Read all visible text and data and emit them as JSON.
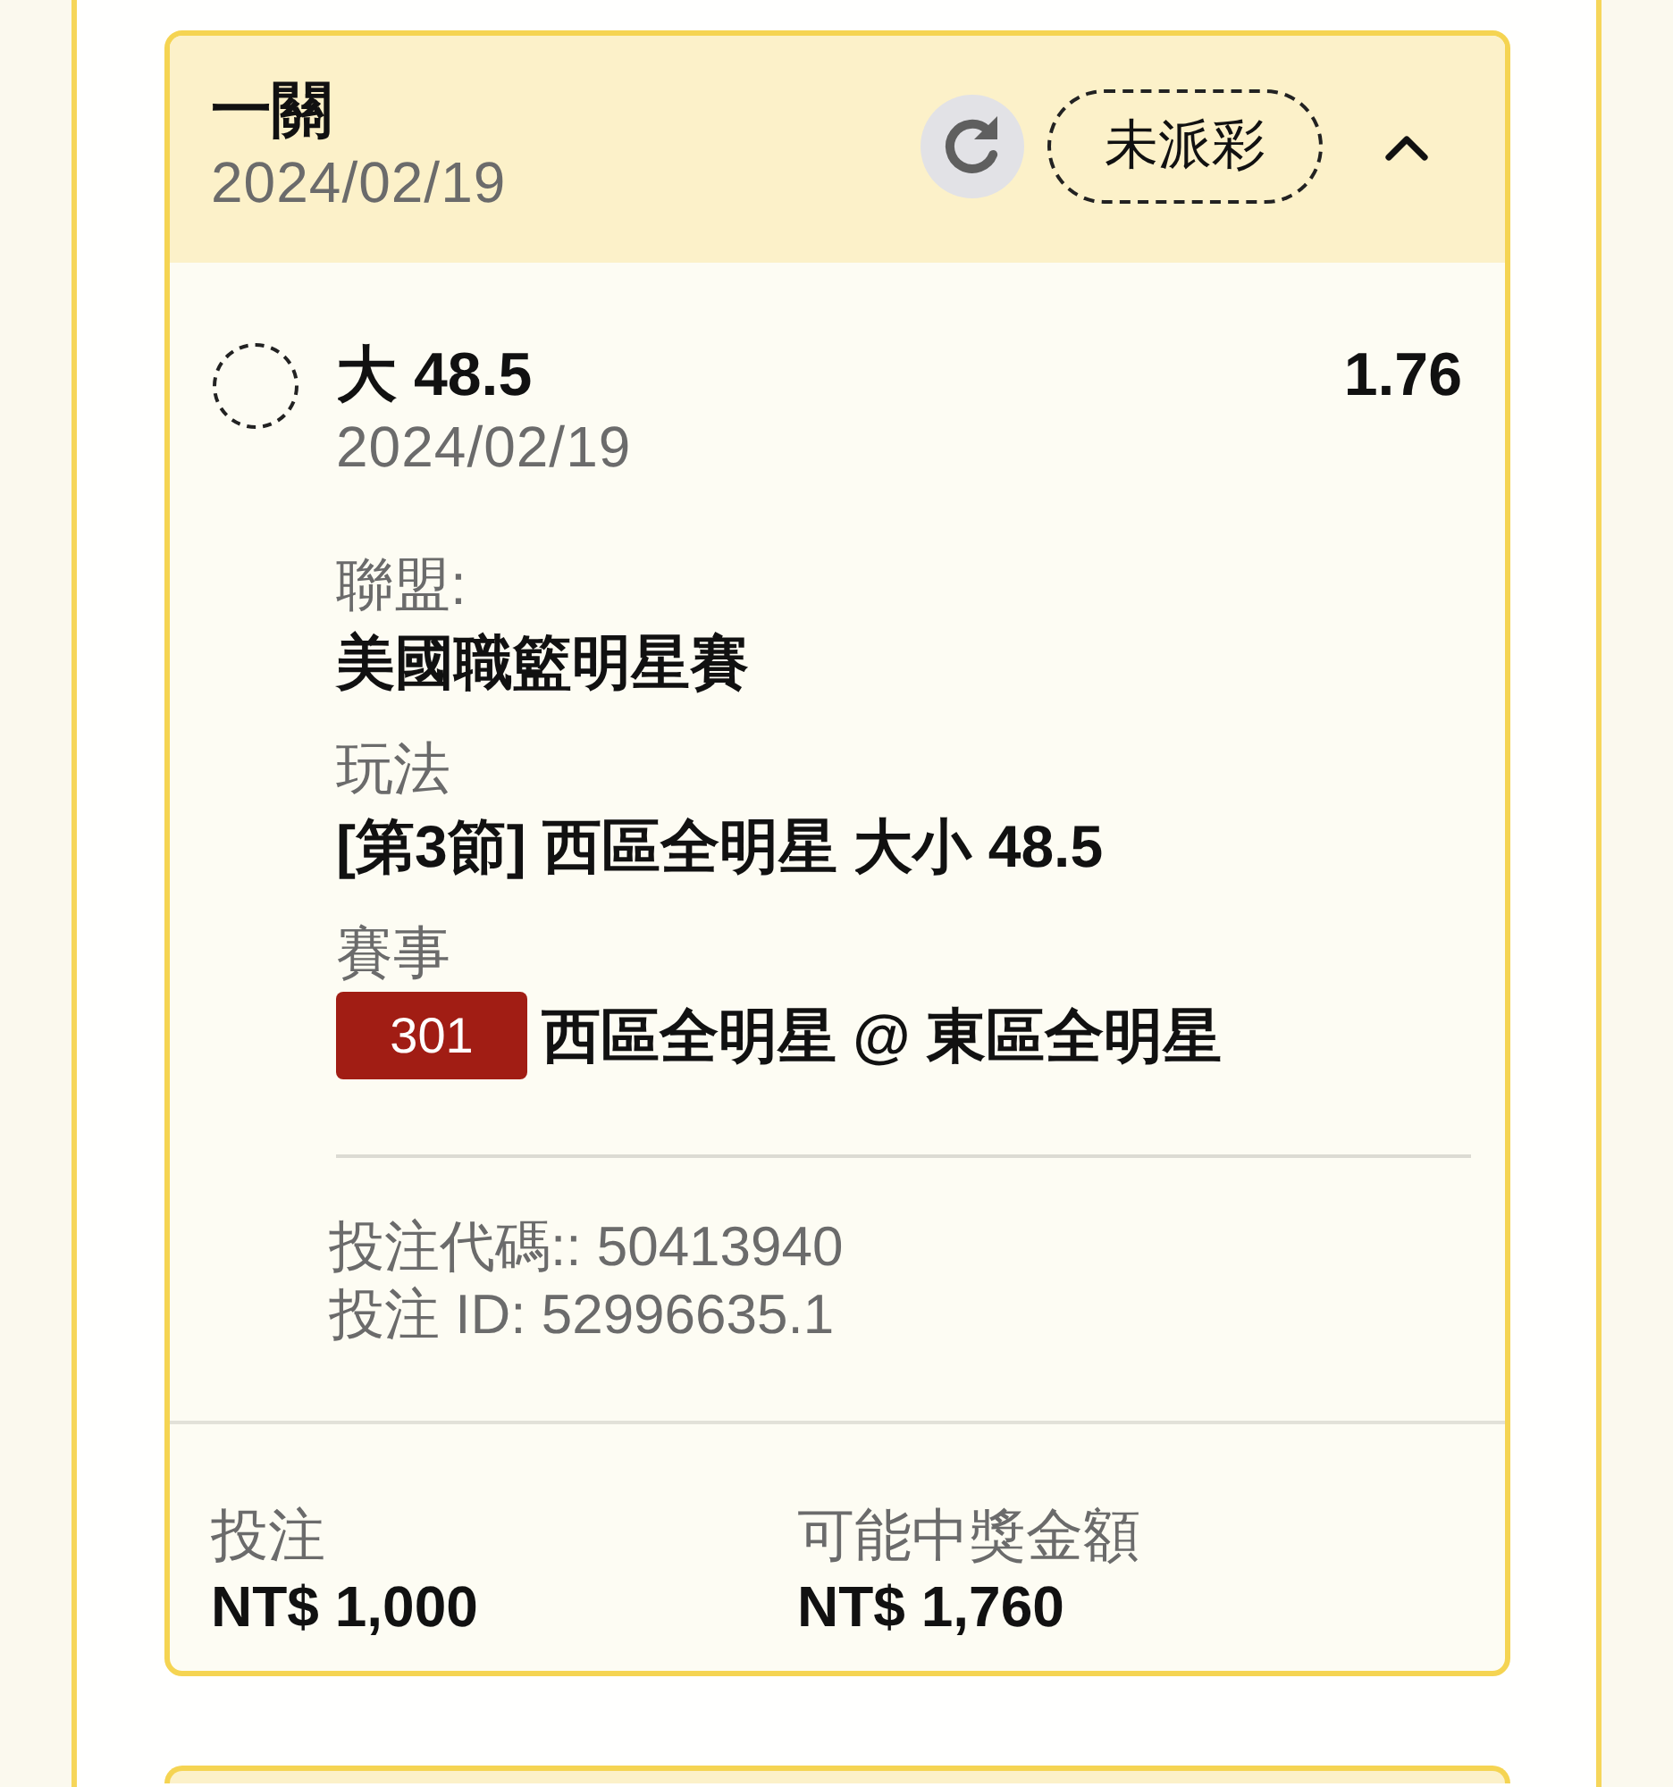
{
  "bet_card": {
    "title": "一關",
    "date": "2024/02/19",
    "status": "未派彩",
    "expanded": true,
    "selection": {
      "name": "大 48.5",
      "odds": "1.76",
      "date": "2024/02/19"
    },
    "details": [
      {
        "label": "聯盟:",
        "value": "美國職籃明星賽"
      },
      {
        "label": "玩法",
        "value": "[第3節] 西區全明星 大小 48.5"
      },
      {
        "label": "賽事",
        "match_number": "301",
        "value": "西區全明星 @ 東區全明星"
      }
    ],
    "references": [
      "投注代碼:: 50413940",
      "投注 ID: 52996635.1"
    ],
    "totals": [
      {
        "label": "投注",
        "value": "NT$ 1,000"
      },
      {
        "label": "可能中獎金額",
        "value": "NT$ 1,760"
      }
    ]
  }
}
